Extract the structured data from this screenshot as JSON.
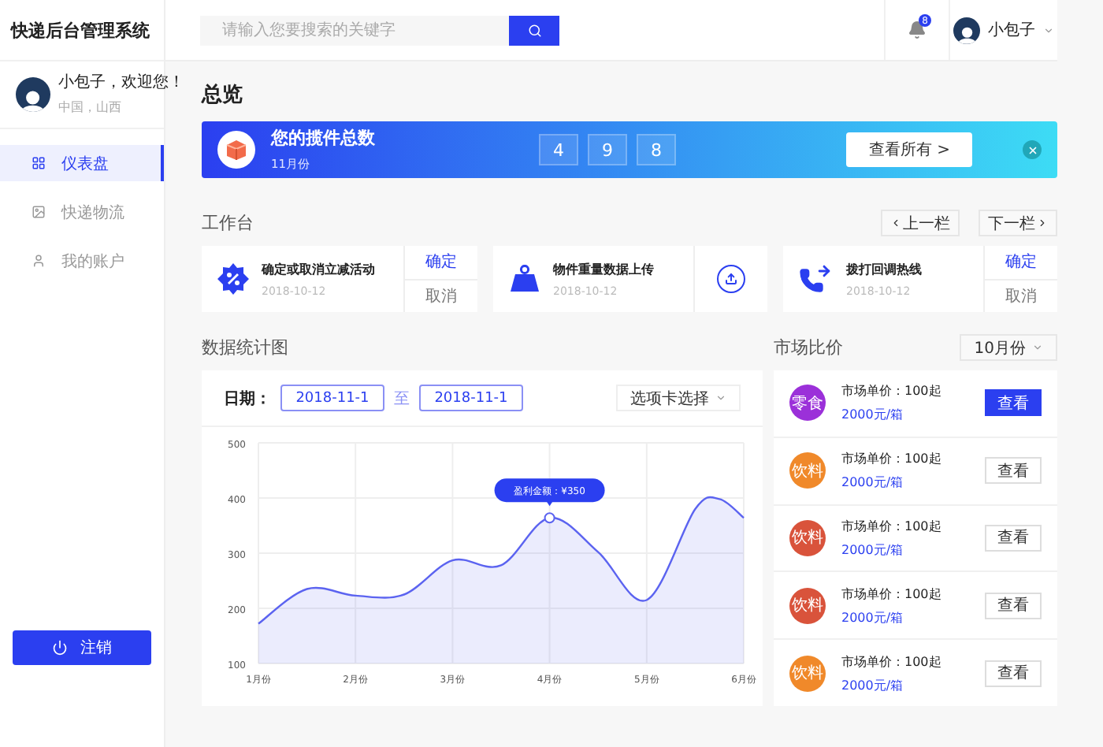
{
  "app_title": "快递后台管理系统",
  "search": {
    "placeholder": "请输入您要搜索的关键字"
  },
  "notifications": {
    "count": "8"
  },
  "user_menu": {
    "name": "小包子"
  },
  "profile": {
    "greeting": "小包子，欢迎您！",
    "location": "中国，山西"
  },
  "nav": [
    {
      "label": "仪表盘",
      "selected": true
    },
    {
      "label": "快递物流",
      "selected": false
    },
    {
      "label": "我的账户",
      "selected": false
    }
  ],
  "logout": "注销",
  "overview": {
    "title": "总览",
    "banner": {
      "title": "您的揽件总数",
      "subtitle": "11月份",
      "digits": [
        "4",
        "9",
        "8"
      ],
      "button": "查看所有 >"
    }
  },
  "workbench": {
    "title": "工作台",
    "prev": "上一栏",
    "next": "下一栏",
    "cards": [
      {
        "title": "确定或取消立减活动",
        "date": "2018-10-12",
        "kind": "confirm",
        "actions": [
          "确定",
          "取消"
        ]
      },
      {
        "title": "物件重量数据上传",
        "date": "2018-10-12",
        "kind": "upload"
      },
      {
        "title": "拨打回调热线",
        "date": "2018-10-12",
        "kind": "confirm",
        "actions": [
          "确定",
          "取消"
        ]
      }
    ]
  },
  "stats": {
    "title": "数据统计图",
    "date_label": "日期：",
    "date_from": "2018-11-1",
    "to": "至",
    "date_to": "2018-11-1",
    "select": "选项卡选择",
    "chart_data": {
      "type": "area",
      "grid": true,
      "x": [
        1,
        1.5,
        2,
        2.5,
        3,
        3.5,
        4,
        4.5,
        5,
        5.5,
        5.75,
        6
      ],
      "series": [
        {
          "color": "#5b63f0",
          "values": [
            172,
            235,
            223,
            225,
            287,
            278,
            364,
            302,
            215,
            380,
            398,
            364
          ]
        }
      ],
      "xlim": [
        1,
        6
      ],
      "ylim": [
        100,
        500
      ],
      "xticks": [
        {
          "value": 1,
          "label": "1月份"
        },
        {
          "value": 2,
          "label": "2月份"
        },
        {
          "value": 3,
          "label": "3月份"
        },
        {
          "value": 4,
          "label": "4月份"
        },
        {
          "value": 5,
          "label": "5月份"
        },
        {
          "value": 6,
          "label": "6月份"
        }
      ],
      "yticks": [
        500,
        400,
        300,
        200,
        100
      ],
      "annotations": [
        {
          "x": 4,
          "y": 364,
          "text": "盈利金额：¥350"
        }
      ]
    }
  },
  "market": {
    "title": "市场比价",
    "month": "10月份",
    "items": [
      {
        "tag": "零食",
        "color": "#9b30d9",
        "price": "市场单价：100起",
        "link": "2000元/箱",
        "button": "查看",
        "selected": true
      },
      {
        "tag": "饮料",
        "color": "#f0892a",
        "price": "市场单价：100起",
        "link": "2000元/箱",
        "button": "查看",
        "selected": false
      },
      {
        "tag": "饮料",
        "color": "#d9533b",
        "price": "市场单价：100起",
        "link": "2000元/箱",
        "button": "查看",
        "selected": false
      },
      {
        "tag": "饮料",
        "color": "#d9533b",
        "price": "市场单价：100起",
        "link": "2000元/箱",
        "button": "查看",
        "selected": false
      },
      {
        "tag": "饮料",
        "color": "#f0892a",
        "price": "市场单价：100起",
        "link": "2000元/箱",
        "button": "查看",
        "selected": false
      }
    ]
  }
}
